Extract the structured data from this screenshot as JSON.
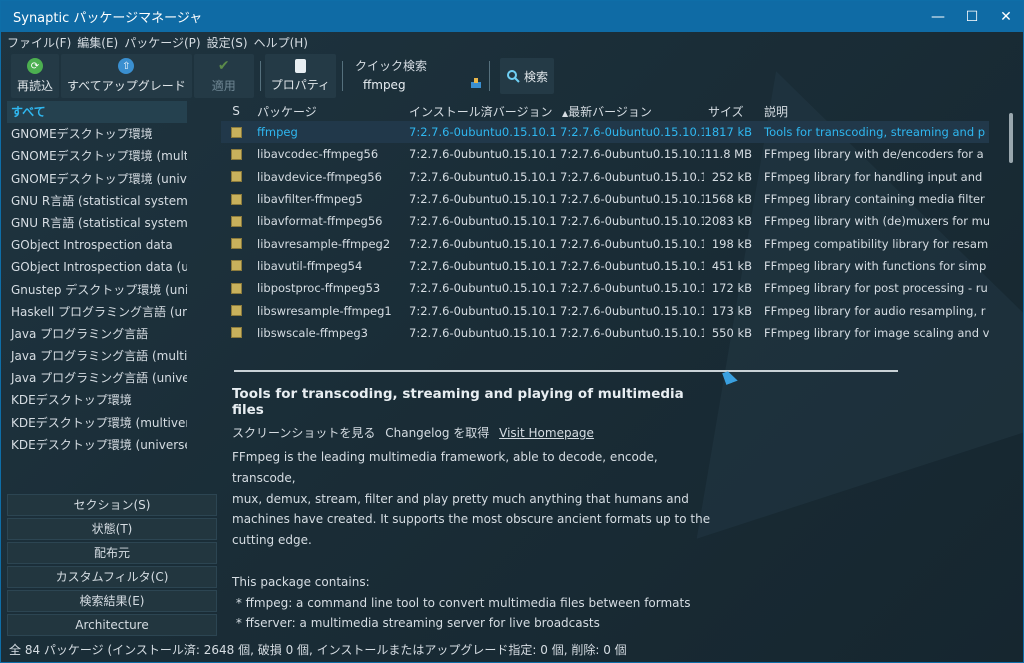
{
  "window": {
    "title": "Synaptic パッケージマネージャ",
    "minimize": "—",
    "maximize": "☐",
    "close": "✕"
  },
  "menubar": [
    "ファイル(F)",
    "編集(E)",
    "パッケージ(P)",
    "設定(S)",
    "ヘルプ(H)"
  ],
  "toolbar": {
    "reload": "再読込",
    "upgrade_all": "すべてアップグレード",
    "apply": "適用",
    "properties": "プロパティ",
    "quick_search_label": "クイック検索",
    "quick_search_value": "ffmpeg",
    "search": "検索"
  },
  "sidebar": {
    "items": [
      "すべて",
      "GNOMEデスクトップ環境",
      "GNOMEデスクトップ環境 (multiv",
      "GNOMEデスクトップ環境 (univer",
      "GNU R言語 (statistical system)",
      "GNU R言語 (statistical system)",
      "GObject Introspection data",
      "GObject Introspection data (u",
      "Gnustep デスクトップ環境 (univ",
      "Haskell プログラミング言語 (uni",
      "Java プログラミング言語",
      "Java プログラミング言語 (multiv",
      "Java プログラミング言語 (univer",
      "KDEデスクトップ環境",
      "KDEデスクトップ環境 (multivers",
      "KDEデスクトップ環境 (universe)"
    ],
    "buttons": [
      "セクション(S)",
      "状態(T)",
      "配布元",
      "カスタムフィルタ(C)",
      "検索結果(E)",
      "Architecture"
    ]
  },
  "table": {
    "headers": {
      "s": "S",
      "package": "パッケージ",
      "installed": "インストール済バージョン",
      "latest": "最新バージョン",
      "size": "サイズ",
      "desc": "説明"
    },
    "rows": [
      {
        "name": "ffmpeg",
        "installed": "7:2.7.6-0ubuntu0.15.10.1",
        "latest": "7:2.7.6-0ubuntu0.15.10.1",
        "size": "1817 kB",
        "desc": "Tools for transcoding, streaming and p"
      },
      {
        "name": "libavcodec-ffmpeg56",
        "installed": "7:2.7.6-0ubuntu0.15.10.1",
        "latest": "7:2.7.6-0ubuntu0.15.10.1",
        "size": "11.8 MB",
        "desc": "FFmpeg library with de/encoders for a"
      },
      {
        "name": "libavdevice-ffmpeg56",
        "installed": "7:2.7.6-0ubuntu0.15.10.1",
        "latest": "7:2.7.6-0ubuntu0.15.10.1",
        "size": "252 kB",
        "desc": "FFmpeg library for handling input and"
      },
      {
        "name": "libavfilter-ffmpeg5",
        "installed": "7:2.7.6-0ubuntu0.15.10.1",
        "latest": "7:2.7.6-0ubuntu0.15.10.1",
        "size": "1568 kB",
        "desc": "FFmpeg library containing media filter"
      },
      {
        "name": "libavformat-ffmpeg56",
        "installed": "7:2.7.6-0ubuntu0.15.10.1",
        "latest": "7:2.7.6-0ubuntu0.15.10.1",
        "size": "2083 kB",
        "desc": "FFmpeg library with (de)muxers for mu"
      },
      {
        "name": "libavresample-ffmpeg2",
        "installed": "7:2.7.6-0ubuntu0.15.10.1",
        "latest": "7:2.7.6-0ubuntu0.15.10.1",
        "size": "198 kB",
        "desc": "FFmpeg compatibility library for resam"
      },
      {
        "name": "libavutil-ffmpeg54",
        "installed": "7:2.7.6-0ubuntu0.15.10.1",
        "latest": "7:2.7.6-0ubuntu0.15.10.1",
        "size": "451 kB",
        "desc": "FFmpeg library with functions for simp"
      },
      {
        "name": "libpostproc-ffmpeg53",
        "installed": "7:2.7.6-0ubuntu0.15.10.1",
        "latest": "7:2.7.6-0ubuntu0.15.10.1",
        "size": "172 kB",
        "desc": "FFmpeg library for post processing - ru"
      },
      {
        "name": "libswresample-ffmpeg1",
        "installed": "7:2.7.6-0ubuntu0.15.10.1",
        "latest": "7:2.7.6-0ubuntu0.15.10.1",
        "size": "173 kB",
        "desc": "FFmpeg library for audio resampling, r"
      },
      {
        "name": "libswscale-ffmpeg3",
        "installed": "7:2.7.6-0ubuntu0.15.10.1",
        "latest": "7:2.7.6-0ubuntu0.15.10.1",
        "size": "550 kB",
        "desc": "FFmpeg library for image scaling and v"
      }
    ]
  },
  "details": {
    "title": "Tools for transcoding, streaming and playing of multimedia files",
    "screenshot_link": "スクリーンショットを見る",
    "changelog_link": "Changelog を取得",
    "homepage_link": "Visit Homepage",
    "paragraph_lines": [
      "FFmpeg is the leading multimedia framework, able to decode, encode, transcode,",
      "mux, demux, stream, filter and play pretty much anything that humans and",
      "machines have created. It supports the most obscure ancient formats up to the",
      "cutting edge."
    ],
    "contains_lines": [
      "This package contains:",
      " * ffmpeg: a command line tool to convert multimedia files between formats",
      " * ffserver: a multimedia streaming server for live broadcasts"
    ]
  },
  "statusbar": "全 84 パッケージ (インストール済: 2648 個, 破損 0 個, インストールまたはアップグレード指定: 0 個, 削除: 0 個",
  "colors": {
    "accent": "#2fb7f0",
    "titlebar": "#0f6ba5",
    "background": "#1c2e38"
  }
}
